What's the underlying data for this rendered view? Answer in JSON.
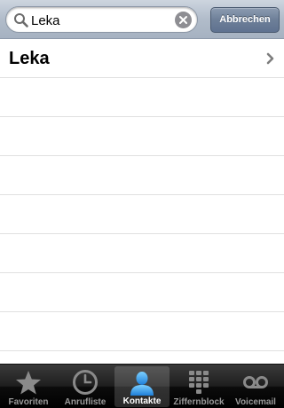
{
  "search": {
    "value": "Leka",
    "cancel_label": "Abbrechen"
  },
  "results": [
    {
      "label": "Leka"
    }
  ],
  "tabs": [
    {
      "label": "Favoriten",
      "icon": "star-icon",
      "active": false
    },
    {
      "label": "Anrufliste",
      "icon": "clock-icon",
      "active": false
    },
    {
      "label": "Kontakte",
      "icon": "contacts-icon",
      "active": true
    },
    {
      "label": "Ziffernblock",
      "icon": "keypad-icon",
      "active": false
    },
    {
      "label": "Voicemail",
      "icon": "voicemail-icon",
      "active": false
    }
  ],
  "colors": {
    "tab_active_icon": "#3aa7f0",
    "tab_inactive_icon": "#8a8a8a"
  }
}
